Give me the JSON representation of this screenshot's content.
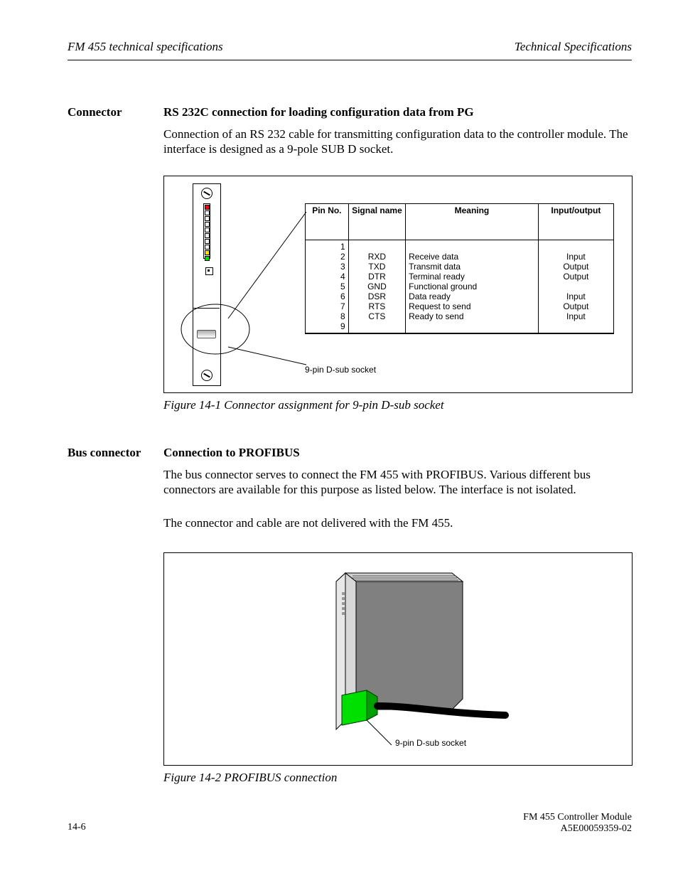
{
  "header": {
    "left": "FM 455 technical specifications",
    "right": "Technical Specifications"
  },
  "section1": {
    "label": "Connector",
    "title": "RS 232C connection for loading configuration data from PG",
    "body": "Connection of an RS 232 cable for transmitting configuration data to the controller module. The interface is designed as a 9-pole SUB D socket."
  },
  "figure1": {
    "table": {
      "headers": [
        "Pin No.",
        "Signal name",
        "Meaning",
        "Input/output"
      ],
      "rows": [
        [
          "1",
          "",
          "",
          ""
        ],
        [
          "2",
          "RXD",
          "Receive data",
          "Input"
        ],
        [
          "3",
          "TXD",
          "Transmit data",
          "Output"
        ],
        [
          "4",
          "DTR",
          "Terminal ready",
          "Output"
        ],
        [
          "5",
          "GND",
          "Functional ground",
          ""
        ],
        [
          "6",
          "DSR",
          "Data ready",
          "Input"
        ],
        [
          "7",
          "RTS",
          "Request to send",
          "Output"
        ],
        [
          "8",
          "CTS",
          "Ready to send",
          "Input"
        ],
        [
          "9",
          "",
          "",
          ""
        ]
      ]
    },
    "pin_label": "9-pin D-sub socket",
    "caption": "Figure 14-1   Connector assignment for 9-pin D-sub socket"
  },
  "section2": {
    "label": "Bus connector",
    "title": "Connection to PROFIBUS",
    "body": "The bus connector serves to connect the FM 455 with PROFIBUS. Various different bus connectors are available for this purpose as listed below. The interface is not isolated.",
    "note": "The connector and cable are not delivered with the FM 455.",
    "conn_label": "9-pin D-sub socket",
    "caption": "Figure 14-2   PROFIBUS connection"
  },
  "footer": {
    "left": "14-6",
    "right_line1": "FM 455 Controller Module",
    "right_line2": "A5E00059359-02"
  },
  "colors": {
    "green": "#00e000",
    "yellow": "#ffe000",
    "red": "#ff0000"
  }
}
